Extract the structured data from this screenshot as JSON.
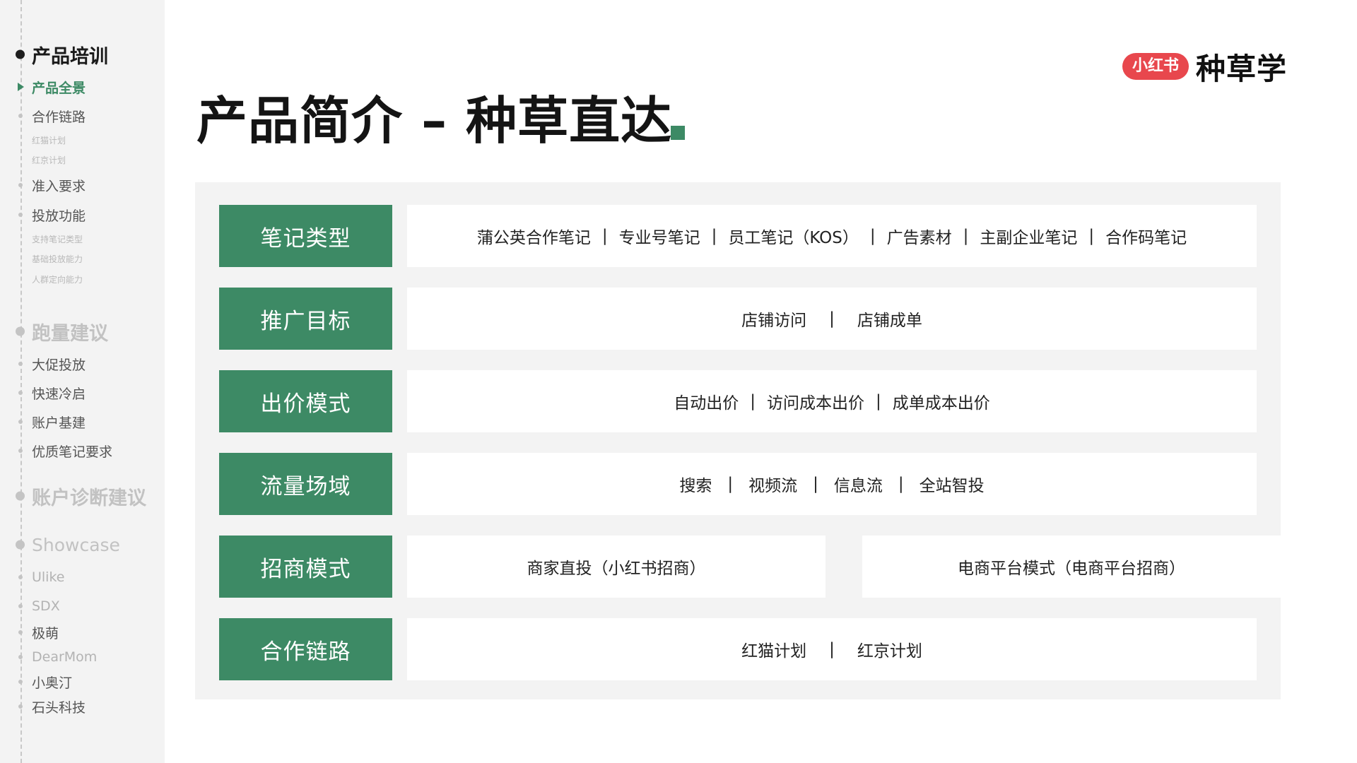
{
  "sidebar": {
    "items": [
      {
        "label": "产品培训"
      },
      {
        "label": "产品全景"
      },
      {
        "label": "合作链路"
      },
      {
        "label": "红猫计划"
      },
      {
        "label": "红京计划"
      },
      {
        "label": "准入要求"
      },
      {
        "label": "投放功能"
      },
      {
        "label": "支持笔记类型"
      },
      {
        "label": "基础投放能力"
      },
      {
        "label": "人群定向能力"
      },
      {
        "label": "跑量建议"
      },
      {
        "label": "大促投放"
      },
      {
        "label": "快速冷启"
      },
      {
        "label": "账户基建"
      },
      {
        "label": "优质笔记要求"
      },
      {
        "label": "账户诊断建议"
      },
      {
        "label": "Showcase"
      },
      {
        "label": "Ulike"
      },
      {
        "label": "SDX"
      },
      {
        "label": "极萌"
      },
      {
        "label": "DearMom"
      },
      {
        "label": "小奥汀"
      },
      {
        "label": "石头科技"
      }
    ]
  },
  "header": {
    "title": "产品简介 – 种草直达",
    "brand_badge": "小红书",
    "brand_name": "种草学"
  },
  "rows": [
    {
      "label": "笔记类型",
      "items": [
        "蒲公英合作笔记",
        "专业号笔记",
        "员工笔记（KOS）",
        "广告素材",
        "主副企业笔记",
        "合作码笔记"
      ]
    },
    {
      "label": "推广目标",
      "items": [
        "店铺访问",
        "店铺成单"
      ]
    },
    {
      "label": "出价模式",
      "items": [
        "自动出价",
        "访问成本出价",
        "成单成本出价"
      ]
    },
    {
      "label": "流量场域",
      "items": [
        "搜索",
        "视频流",
        "信息流",
        "全站智投"
      ]
    },
    {
      "label": "招商模式",
      "left": "商家直投（小红书招商）",
      "right": "电商平台模式（电商平台招商）"
    },
    {
      "label": "合作链路",
      "items": [
        "红猫计划",
        "红京计划"
      ]
    }
  ],
  "separator": "|",
  "colors": {
    "accent_green": "#3d8a65",
    "brand_red": "#e8474d",
    "panel_bg": "#f3f3f3",
    "sidebar_bg": "#f3f3f3"
  }
}
